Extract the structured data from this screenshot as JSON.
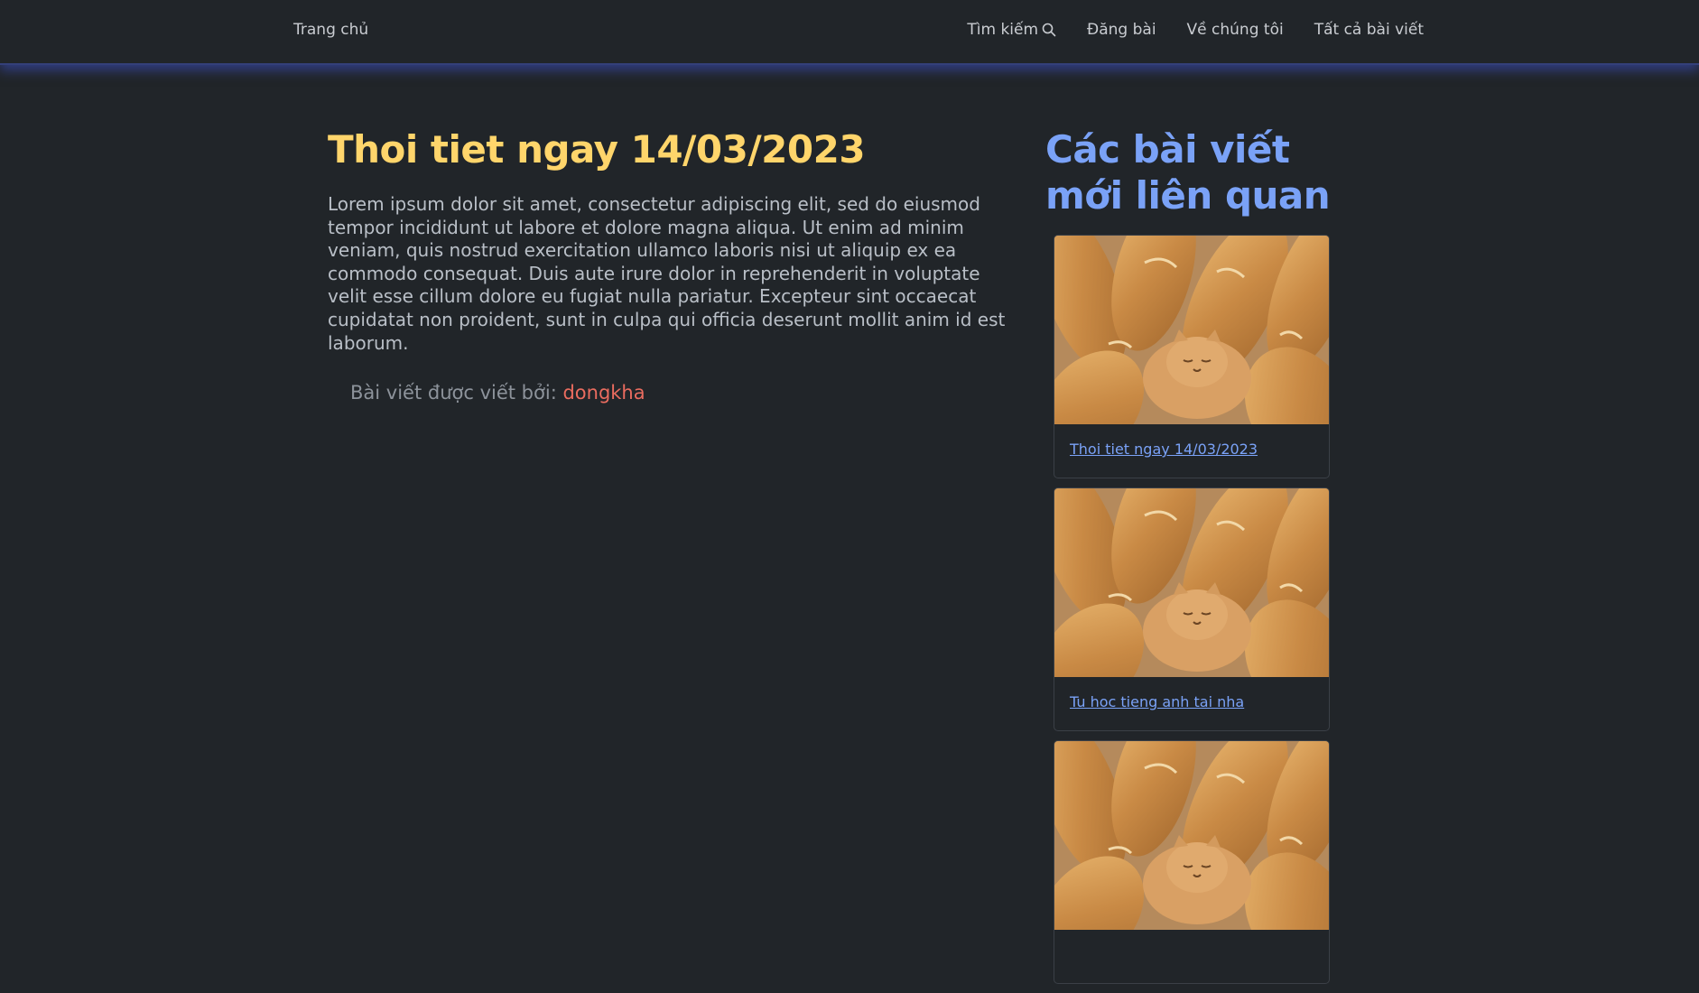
{
  "nav": {
    "brand": "Trang chủ",
    "links": [
      {
        "label": "Tìm kiếm",
        "icon": "search-icon"
      },
      {
        "label": "Đăng bài"
      },
      {
        "label": "Về chúng tôi"
      },
      {
        "label": "Tất cả bài viết"
      }
    ]
  },
  "article": {
    "title": "Thoi tiet ngay 14/03/2023",
    "body": "Lorem ipsum dolor sit amet, consectetur adipiscing elit, sed do eiusmod tempor incididunt ut labore et dolore magna aliqua. Ut enim ad minim veniam, quis nostrud exercitation ullamco laboris nisi ut aliquip ex ea commodo consequat. Duis aute irure dolor in reprehenderit in voluptate velit esse cillum dolore eu fugiat nulla pariatur. Excepteur sint occaecat cupidatat non proident, sunt in culpa qui officia deserunt mollit anim id est laborum.",
    "byline_prefix": "Bài viết được viết bởi:",
    "author": "dongkha"
  },
  "sidebar": {
    "title": "Các bài viết mới liên quan",
    "posts": [
      {
        "title": "Thoi tiet ngay 14/03/2023"
      },
      {
        "title": "Tu hoc tieng anh tai nha"
      },
      {
        "title": ""
      }
    ]
  },
  "colors": {
    "background": "#212529",
    "title_yellow": "#ffd56b",
    "accent_blue": "#7aa2f7",
    "author_red": "#ea6c5f"
  }
}
